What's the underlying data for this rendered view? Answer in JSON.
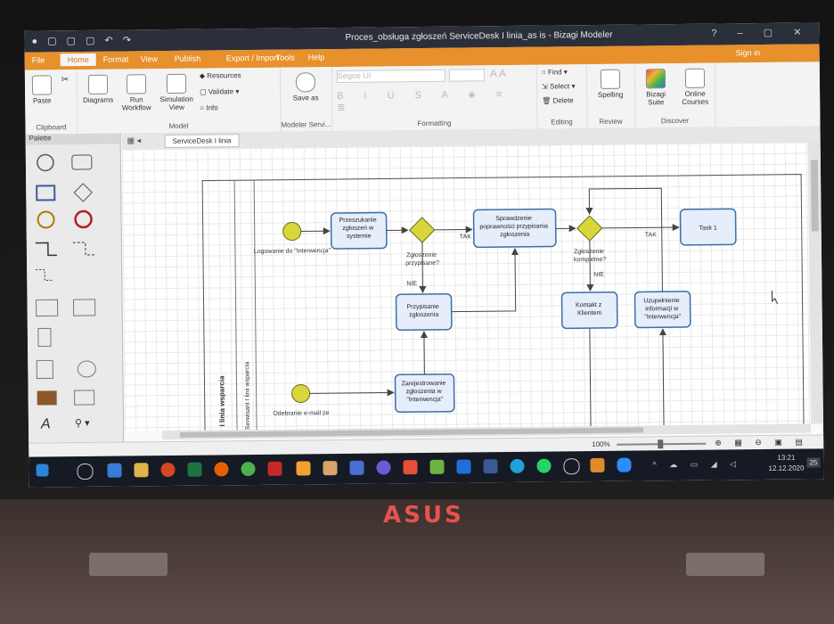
{
  "window": {
    "title": "Proces_obsługa zgłoszeń ServiceDesk I linia_as is - Bizagi Modeler"
  },
  "menu": [
    "File",
    "Home",
    "Format",
    "View",
    "Publish",
    "Export / Import",
    "Tools",
    "Help"
  ],
  "signin": "Sign in",
  "ribbon": {
    "paste": "Paste",
    "clipboard_label": "Clipboard",
    "diagrams": "Diagrams",
    "run": "Run",
    "workflow": "Workflow",
    "simulation": "Simulation",
    "view": "View",
    "resources": "Resources",
    "validate": "Validate",
    "info": "Info",
    "model_label": "Model",
    "save_as": "Save as",
    "modeler_services_label": "Modeler Servi...",
    "font_name": "Segoe UI",
    "formatting_label": "Formatting",
    "find": "Find",
    "select": "Select",
    "delete": "Delete",
    "editing_label": "Editing",
    "spelling": "Spelling",
    "review_label": "Review",
    "bizagi_suite": "Bizagi Suite",
    "online_courses": "Online Courses",
    "discover_label": "Discover"
  },
  "palette": {
    "title": "Palette"
  },
  "tabs": {
    "active": "ServiceDesk I linia"
  },
  "diagram": {
    "lane1": "I linia wsparcia",
    "lane2": "Serwisant I linii wsparcia",
    "start1": "Logowanie do \"Interwencja\"",
    "start2": "Odebranie e-mail ze",
    "t_przeszukanie": [
      "Przeszukanie",
      "zgłoszeń w",
      "systemie"
    ],
    "g1": [
      "Zgłoszenie",
      "przypisane?"
    ],
    "t_sprawdzenie": [
      "Sprawdzenie",
      "poprawności przypisania",
      "zgłoszenia"
    ],
    "g2": [
      "Zgłoszenie",
      "kompletne?"
    ],
    "task1": "Task 1",
    "t_przypisanie": [
      "Przypisanie",
      "zgłoszenia"
    ],
    "t_kontakt": [
      "Kontakt z",
      "Klientem"
    ],
    "t_uzupelnienie": [
      "Uzupełnienie",
      "informacji w",
      "\"Interwencja\""
    ],
    "t_zarejestrowanie": [
      "Zarejestrowanie",
      "zgłoszenia w",
      "\"Interwencja\""
    ],
    "tak": "TAK",
    "nie": "NIE"
  },
  "status": {
    "zoom": "100%"
  },
  "taskbar": {
    "time": "13:21",
    "date": "12.12.2020",
    "notif": "25"
  },
  "brand": "ASUS",
  "colors": {
    "accent": "#e7902c",
    "task_fill": "#e6eefb",
    "task_stroke": "#3c6fa8",
    "event": "#d8d63a"
  }
}
